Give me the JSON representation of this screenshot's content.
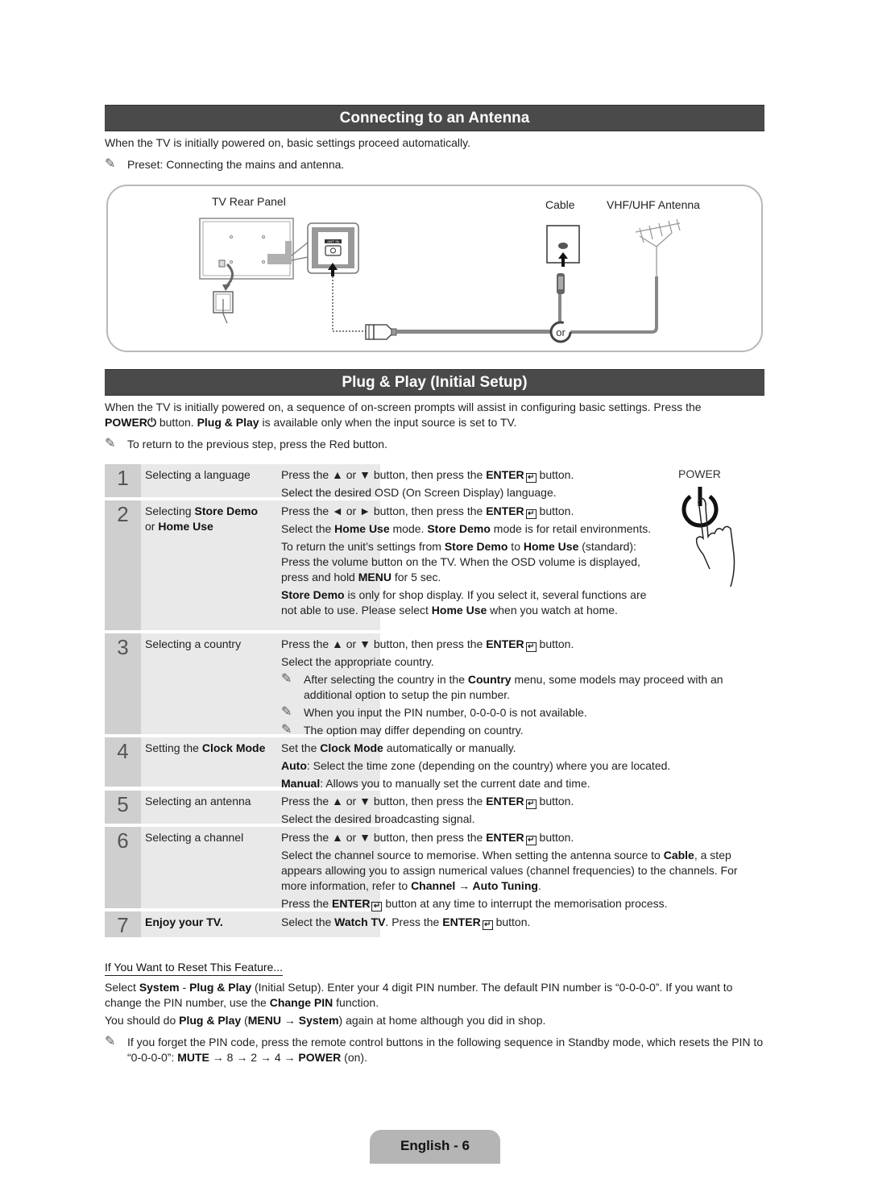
{
  "section1": {
    "title": "Connecting to an Antenna",
    "intro": "When the TV is initially powered on, basic settings proceed automatically.",
    "note": "Preset: Connecting the mains and antenna.",
    "diagram": {
      "tv_rear_panel_label": "TV Rear Panel",
      "port_label": "ANT IN",
      "cable_label": "Cable",
      "antenna_label": "VHF/UHF Antenna",
      "or_label": "or"
    }
  },
  "section2": {
    "title": "Plug & Play (Initial Setup)",
    "intro_line1": "When the TV is initially powered on, a sequence of on-screen prompts will assist in configuring basic settings. Press the",
    "intro_power": "POWER",
    "intro_after_power": " button. ",
    "intro_bold": "Plug & Play",
    "intro_end": " is available only when the input source is set to TV.",
    "note": "To return to the previous step, press the Red button.",
    "power_illustration_label": "POWER"
  },
  "steps": [
    {
      "number": "1",
      "name": "Selecting a language",
      "lines": {
        "l1a": "Press the ▲ or ▼ button, then press the ",
        "enter": "ENTER",
        "l1b": " button.",
        "l2": "Select the desired OSD (On Screen Display) language."
      }
    },
    {
      "number": "2",
      "name_pre": "Selecting ",
      "name_b1": "Store Demo",
      "name_mid": "or ",
      "name_b2": "Home Use",
      "lines": {
        "l1a": "Press the ◄ or ► button, then press the ",
        "enter": "ENTER",
        "l1b": " button.",
        "l2a": "Select the ",
        "l2b": "Home Use",
        "l2c": " mode. ",
        "l2d": "Store Demo",
        "l2e": " mode is for retail environments.",
        "l3a": "To return the unit’s settings from ",
        "l3b": "Store Demo",
        "l3c": " to ",
        "l3d": "Home Use",
        "l3e": " (standard): Press the volume button on the TV. When the OSD volume is displayed, press and hold ",
        "l3f": "MENU",
        "l3g": " for 5 sec.",
        "l4a": "Store Demo",
        "l4b": " is only for shop display. If you select it, several functions are not able to use. Please select ",
        "l4c": "Home Use",
        "l4d": " when you watch at home."
      }
    },
    {
      "number": "3",
      "name": "Selecting a country",
      "lines": {
        "l1a": "Press the ▲ or ▼ button, then press the ",
        "enter": "ENTER",
        "l1b": " button.",
        "l2": "Select the appropriate country.",
        "n1a": "After selecting the country in the ",
        "n1b": "Country",
        "n1c": " menu, some models may proceed with an additional option to setup the pin number.",
        "n2": "When you input the PIN number, 0-0-0-0 is not available.",
        "n3": "The option may differ depending on country."
      }
    },
    {
      "number": "4",
      "name_pre": "Setting the ",
      "name_b1": "Clock Mode",
      "lines": {
        "l1a": "Set the ",
        "l1b": "Clock Mode",
        "l1c": " automatically or manually.",
        "l2a": "Auto",
        "l2b": ": Select the time zone (depending on the country) where you are located.",
        "l3a": "Manual",
        "l3b": ": Allows you to manually set the current date and time."
      }
    },
    {
      "number": "5",
      "name": "Selecting an antenna",
      "lines": {
        "l1a": "Press the ▲ or ▼ button, then press the ",
        "enter": "ENTER",
        "l1b": " button.",
        "l2": "Select the desired broadcasting signal."
      }
    },
    {
      "number": "6",
      "name": "Selecting a channel",
      "lines": {
        "l1a": "Press the ▲ or ▼ button, then press the ",
        "enter": "ENTER",
        "l1b": " button.",
        "l2a": "Select the channel source to memorise. When setting the antenna source to ",
        "l2b": "Cable",
        "l2c": ", a step appears allowing you to assign numerical values (channel frequencies) to the channels. For more information, refer to ",
        "l2d": "Channel → Auto Tuning",
        "l2e": ".",
        "l3a": "Press the ",
        "l3b": "ENTER",
        "l3c": " button at any time to interrupt the memorisation process."
      }
    },
    {
      "number": "7",
      "name": "Enjoy your TV.",
      "lines": {
        "l1a": "Select the ",
        "l1b": "Watch TV",
        "l1c": ". Press the ",
        "enter": "ENTER",
        "l1d": " button."
      }
    }
  ],
  "reset": {
    "heading": "If You Want to Reset This Feature...",
    "p1a": "Select ",
    "p1b": "System",
    "p1c": " - ",
    "p1d": "Plug & Play",
    "p1e": " (Initial Setup). Enter your 4 digit PIN number. The default PIN number is “0-0-0-0”. If you want to change the PIN number, use the ",
    "p1f": "Change PIN",
    "p1g": " function.",
    "p2a": "You should do ",
    "p2b": "Plug & Play",
    "p2c": " (",
    "p2d": "MENU",
    "p2e": " → ",
    "p2f": "System",
    "p2g": ") again at home although you did in shop.",
    "n1a": "If you forget the PIN code, press the remote control buttons in the following sequence in Standby mode, which resets the PIN to “0-0-0-0”: ",
    "n1b": "MUTE",
    "n1c": " → 8 → 2 → 4 → ",
    "n1d": "POWER",
    "n1e": " (on)."
  },
  "footer": {
    "page_label": "English - 6"
  },
  "icons": {
    "note": "pencil-note-icon",
    "enter": "enter-key-icon",
    "power": "power-icon"
  },
  "colors": {
    "section_bar": "#4a4a4a",
    "step_number_bg": "#cfcfcf",
    "step_name_bg": "#e9e9e9",
    "footer_tab": "#b5b5b5"
  }
}
